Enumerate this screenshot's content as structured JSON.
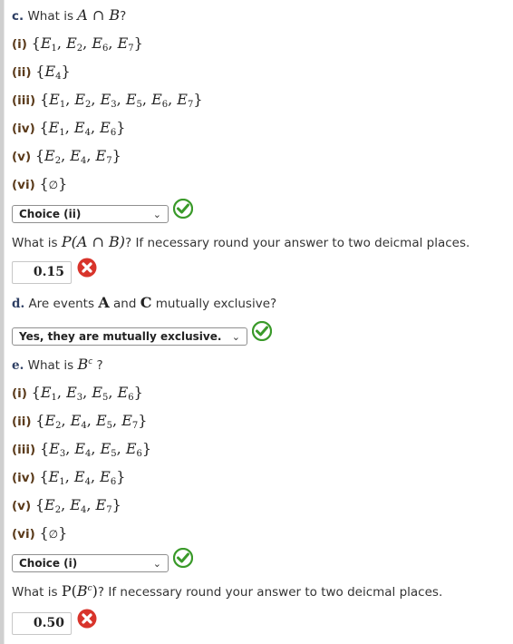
{
  "part_c": {
    "label": "c.",
    "question_prefix": "What is",
    "question_math": "A ∩ B",
    "question_suffix": "?",
    "options": [
      {
        "label": "(i)",
        "set": [
          "E1",
          "E2",
          "E6",
          "E7"
        ]
      },
      {
        "label": "(ii)",
        "set": [
          "E4"
        ]
      },
      {
        "label": "(iii)",
        "set": [
          "E1",
          "E2",
          "E3",
          "E5",
          "E6",
          "E7"
        ]
      },
      {
        "label": "(iv)",
        "set": [
          "E1",
          "E4",
          "E6"
        ]
      },
      {
        "label": "(v)",
        "set": [
          "E2",
          "E4",
          "E7"
        ]
      },
      {
        "label": "(vi)",
        "set": [
          "∅"
        ]
      }
    ],
    "select_value": "Choice (ii)",
    "select_status": "correct",
    "prob_prefix": "What is",
    "prob_math": "P(A ∩ B)",
    "prob_suffix": "? If necessary round your answer to two deicmal places.",
    "prob_answer": "0.15",
    "prob_status": "incorrect"
  },
  "part_d": {
    "label": "d.",
    "question_prefix": "Are events",
    "event1": "A",
    "and": "and",
    "event2": "C",
    "question_suffix": "mutually exclusive?",
    "select_value": "Yes, they are mutually exclusive.",
    "select_status": "correct"
  },
  "part_e": {
    "label": "e.",
    "question_prefix": "What is",
    "question_math": "B",
    "question_sup": "c",
    "question_suffix": "?",
    "options": [
      {
        "label": "(i)",
        "set": [
          "E1",
          "E3",
          "E5",
          "E6"
        ]
      },
      {
        "label": "(ii)",
        "set": [
          "E2",
          "E4",
          "E5",
          "E7"
        ]
      },
      {
        "label": "(iii)",
        "set": [
          "E3",
          "E4",
          "E5",
          "E6"
        ]
      },
      {
        "label": "(iv)",
        "set": [
          "E1",
          "E4",
          "E6"
        ]
      },
      {
        "label": "(v)",
        "set": [
          "E2",
          "E4",
          "E7"
        ]
      },
      {
        "label": "(vi)",
        "set": [
          "∅"
        ]
      }
    ],
    "select_value": "Choice (i)",
    "select_status": "correct",
    "prob_prefix": "What is",
    "prob_math_p": "P(",
    "prob_math_b": "B",
    "prob_math_sup": "c",
    "prob_math_close": ")",
    "prob_suffix": "? If necessary round your answer to two deicmal places.",
    "prob_answer": "0.50",
    "prob_status": "incorrect"
  },
  "colors": {
    "correct": "#3a9a2a",
    "incorrect": "#d8342b",
    "label": "#2d3e63",
    "option_label": "#5a3a1a"
  },
  "icons": {
    "correct": "check-circle-icon",
    "incorrect": "x-circle-icon",
    "dropdown": "chevron-down-icon"
  }
}
